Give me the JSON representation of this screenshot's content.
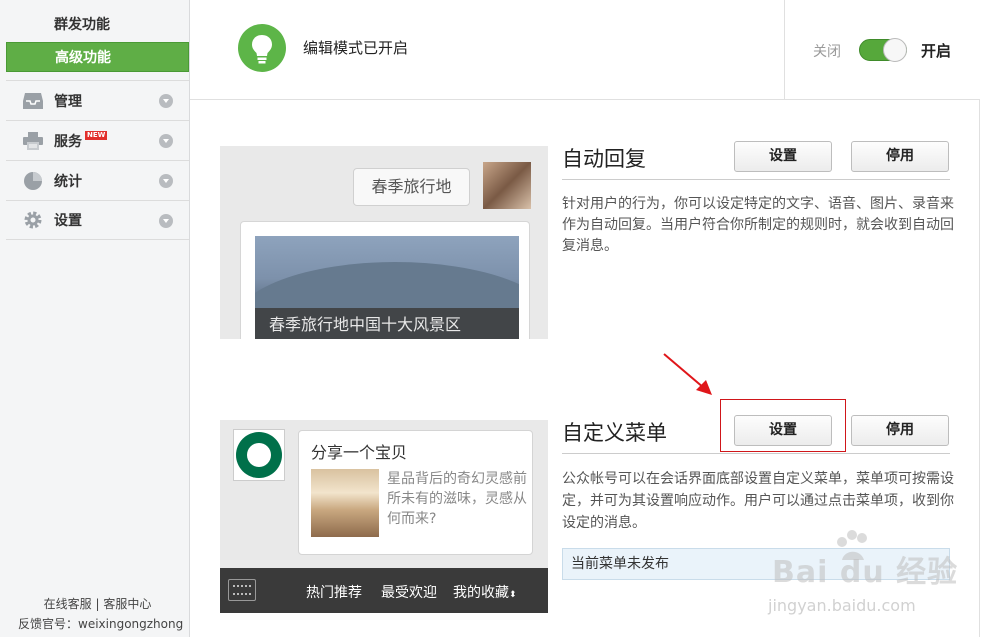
{
  "sidebar": {
    "sub_items": [
      "群发功能",
      "高级功能"
    ],
    "items": [
      {
        "label": "管理",
        "icon": "inbox-icon"
      },
      {
        "label": "服务",
        "icon": "printer-icon",
        "badge": "NEW"
      },
      {
        "label": "统计",
        "icon": "pie-chart-icon"
      },
      {
        "label": "设置",
        "icon": "gear-icon"
      }
    ],
    "footer": {
      "support": "在线客服",
      "separator": "|",
      "center": "客服中心",
      "feedback": "反馈官号：weixingongzhong"
    }
  },
  "header": {
    "icon": "lightbulb-icon",
    "title": "编辑模式已开启",
    "toggle_off_label": "关闭",
    "toggle_on_label": "开启",
    "toggle_state": "on"
  },
  "auto_reply": {
    "title": "自动回复",
    "set_label": "设置",
    "stop_label": "停用",
    "description": "针对用户的行为，你可以设定特定的文字、语音、图片、录音来作为自动回复。当用户符合你所制定的规则时，就会收到自动回复消息。",
    "preview": {
      "bubble_text": "春季旅行地",
      "article_caption": "春季旅行地中国十大风景区"
    }
  },
  "custom_menu": {
    "title": "自定义菜单",
    "set_label": "设置",
    "stop_label": "停用",
    "description": "公众帐号可以在会话界面底部设置自定义菜单，菜单项可按需设定，并可为其设置响应动作。用户可以通过点击菜单项，收到你设定的消息。",
    "status": "当前菜单未发布",
    "preview": {
      "share_title": "分享一个宝贝",
      "share_desc": "星品背后的奇幻灵感前所未有的滋味，灵感从何而来?",
      "menu_items": [
        "热门推荐",
        "最受欢迎",
        "我的收藏"
      ]
    }
  },
  "watermark": {
    "brand": "Bai du 经验",
    "url": "jingyan.baidu.com"
  },
  "colors": {
    "accent_green": "#5fae46",
    "highlight_red": "#d0161a"
  }
}
